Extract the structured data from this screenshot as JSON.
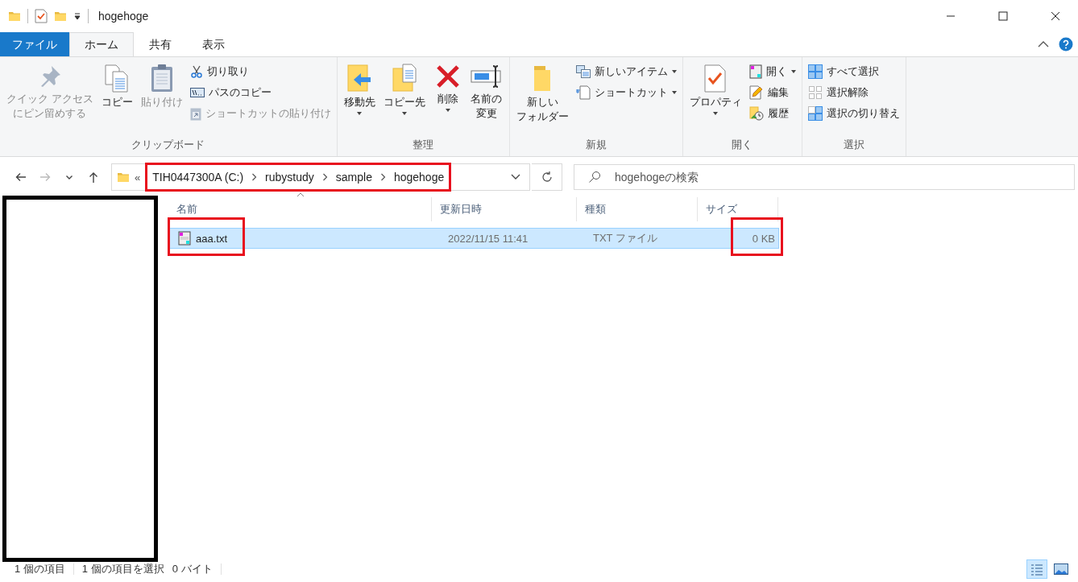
{
  "title_bar": {
    "title": "hogehoge"
  },
  "ribbon_tabs": [
    {
      "label": "ファイル",
      "kind": "file",
      "selected": false
    },
    {
      "label": "ホーム",
      "kind": "tab",
      "selected": true
    },
    {
      "label": "共有",
      "kind": "tab",
      "selected": false
    },
    {
      "label": "表示",
      "kind": "tab",
      "selected": false
    }
  ],
  "ribbon_groups": [
    {
      "label": "クリップボード",
      "items": [
        {
          "kind": "large",
          "label": "クイック アクセスにピン留めする",
          "disabled": true,
          "dropdown": false
        },
        {
          "kind": "large",
          "label": "コピー",
          "disabled": false,
          "dropdown": false
        },
        {
          "kind": "large",
          "label": "貼り付け",
          "disabled": true,
          "dropdown": false
        },
        {
          "kind": "stack",
          "items": [
            {
              "label": "切り取り",
              "disabled": false,
              "dropdown": false
            },
            {
              "label": "パスのコピー",
              "disabled": false,
              "dropdown": false
            },
            {
              "label": "ショートカットの貼り付け",
              "disabled": true,
              "dropdown": false
            }
          ]
        }
      ]
    },
    {
      "label": "整理",
      "items": [
        {
          "kind": "large",
          "label": "移動先",
          "disabled": false,
          "dropdown": true
        },
        {
          "kind": "large",
          "label": "コピー先",
          "disabled": false,
          "dropdown": true
        },
        {
          "kind": "large",
          "label": "削除",
          "disabled": false,
          "dropdown": true
        },
        {
          "kind": "large",
          "label": "名前の変更",
          "disabled": false,
          "dropdown": false
        }
      ]
    },
    {
      "label": "新規",
      "items": [
        {
          "kind": "large",
          "label": "新しいフォルダー",
          "disabled": false,
          "dropdown": false
        },
        {
          "kind": "stack",
          "items": [
            {
              "label": "新しいアイテム",
              "disabled": false,
              "dropdown": true
            },
            {
              "label": "ショートカット",
              "disabled": false,
              "dropdown": true
            }
          ]
        }
      ]
    },
    {
      "label": "開く",
      "items": [
        {
          "kind": "large",
          "label": "プロパティ",
          "disabled": false,
          "dropdown": true
        },
        {
          "kind": "stack",
          "items": [
            {
              "label": "開く",
              "disabled": false,
              "dropdown": true
            },
            {
              "label": "編集",
              "disabled": false,
              "dropdown": false
            },
            {
              "label": "履歴",
              "disabled": false,
              "dropdown": false
            }
          ]
        }
      ]
    },
    {
      "label": "選択",
      "items": [
        {
          "kind": "stack",
          "items": [
            {
              "label": "すべて選択",
              "disabled": false,
              "dropdown": false
            },
            {
              "label": "選択解除",
              "disabled": false,
              "dropdown": false
            },
            {
              "label": "選択の切り替え",
              "disabled": false,
              "dropdown": false
            }
          ]
        }
      ]
    }
  ],
  "nav_buttons": [
    {
      "kind": "back",
      "disabled": false
    },
    {
      "kind": "forward",
      "disabled": true
    },
    {
      "kind": "recent",
      "disabled": false
    },
    {
      "kind": "up",
      "disabled": false
    }
  ],
  "address": {
    "overflow": "«",
    "highlighted": true,
    "crumbs": [
      "TIH0447300A (C:)",
      "rubystudy",
      "sample",
      "hogehoge"
    ]
  },
  "search": {
    "placeholder": "hogehogeの検索"
  },
  "navigation_pane": {
    "masked": true
  },
  "file_list": {
    "columns": [
      {
        "label": "名前",
        "sorted": true
      },
      {
        "label": "更新日時",
        "sorted": false
      },
      {
        "label": "種類",
        "sorted": false
      },
      {
        "label": "サイズ",
        "sorted": false
      }
    ],
    "rows": [
      {
        "selected": true,
        "cells": [
          {
            "text": "aaa.txt",
            "highlighted": true
          },
          {
            "text": "2022/11/15 11:41",
            "highlighted": false
          },
          {
            "text": "TXT ファイル",
            "highlighted": false
          },
          {
            "text": "0 KB",
            "highlighted": true
          }
        ]
      }
    ]
  },
  "status_bar": {
    "items": [
      "1 個の項目",
      "1 個の項目を選択",
      "0 バイト"
    ]
  },
  "view_buttons": [
    {
      "kind": "details",
      "selected": true
    },
    {
      "kind": "large_icons",
      "selected": false
    }
  ]
}
